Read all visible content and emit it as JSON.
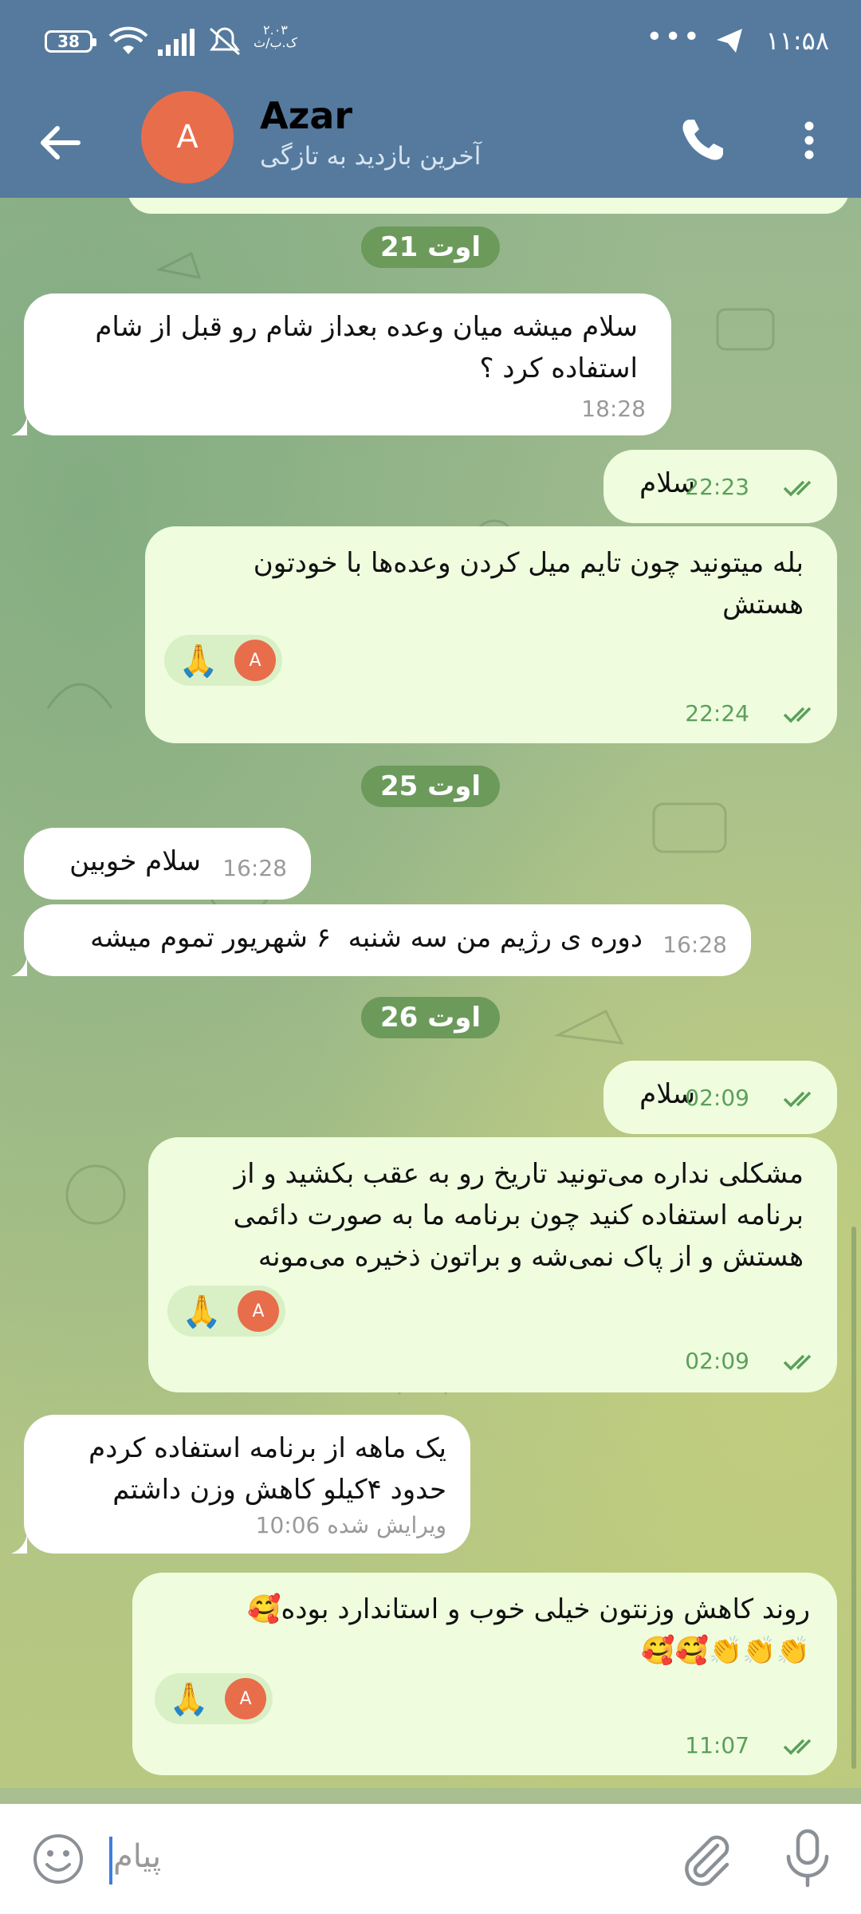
{
  "status_bar": {
    "battery": "38",
    "time": "۱۱:۵۸",
    "speed_top": "۲.۰۳",
    "speed_bottom": "ک.ب/ث"
  },
  "header": {
    "avatar_letter": "A",
    "title": "Azar",
    "subtitle": "آخرین بازدید به تازگی"
  },
  "messages": [
    {
      "type": "date",
      "text": "21 اوت"
    },
    {
      "type": "in",
      "text": "سلام میشه میان وعده بعداز شام رو قبل از شام\nاستفاده کرد ؟",
      "time": "18:28"
    },
    {
      "type": "out",
      "text": "سلام",
      "time": "22:23"
    },
    {
      "type": "out",
      "text": "بله میتونید چون تایم میل کردن وعده‌ها با خودتون\nهستش",
      "time": "22:24",
      "reaction": "🙏",
      "reaction_avatar": "A"
    },
    {
      "type": "date",
      "text": "25 اوت"
    },
    {
      "type": "in",
      "text": "سلام خوبین",
      "time": "16:28"
    },
    {
      "type": "in",
      "text": "دوره ی رژیم من سه شنبه  ۶ شهریور تموم میشه",
      "time": "16:28"
    },
    {
      "type": "date",
      "text": "26 اوت"
    },
    {
      "type": "out",
      "text": "سلام",
      "time": "02:09"
    },
    {
      "type": "out",
      "text": "مشکلی نداره می‌تونید تاریخ رو به عقب بکشید و از\nبرنامه استفاده کنید چون برنامه ما به صورت دائمی\nهستش و از پاک نمی‌شه و براتون ذخیره می‌مونه",
      "time": "02:09",
      "reaction": "🙏",
      "reaction_avatar": "A"
    },
    {
      "type": "in",
      "text": "یک ماهه از برنامه استفاده کردم\nحدود ۴کیلو کاهش وزن داشتم",
      "time": "ویرایش شده 10:06"
    },
    {
      "type": "out",
      "text": "روند کاهش وزنتون خیلی خوب و استاندارد بوده🥰\n👏👏👏🥰🥰",
      "time": "11:07",
      "reaction": "🙏",
      "reaction_avatar": "A"
    }
  ],
  "input": {
    "placeholder": "پیام"
  },
  "icons": {
    "back": "arrow-left-icon",
    "call": "phone-icon",
    "menu": "more-vertical-icon",
    "emoji": "emoji-icon",
    "attach": "paperclip-icon",
    "mic": "microphone-icon"
  },
  "colors": {
    "header": "#557a9e",
    "incoming": "#ffffff",
    "outgoing": "#effdde",
    "date_chip": "#6b9a5b",
    "avatar": "#e86d4b"
  }
}
